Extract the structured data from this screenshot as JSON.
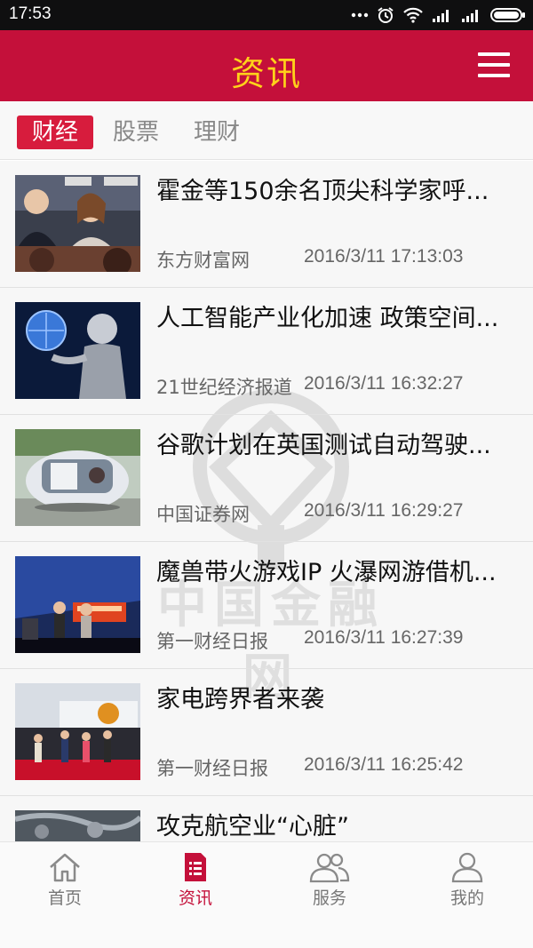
{
  "status_bar": {
    "time": "17:53"
  },
  "header": {
    "title": "资讯"
  },
  "tabs": [
    {
      "label": "财经",
      "active": true
    },
    {
      "label": "股票",
      "active": false
    },
    {
      "label": "理财",
      "active": false
    }
  ],
  "watermark": {
    "text": "中国金融网"
  },
  "news": [
    {
      "title": "霍金等150余名顶尖科学家呼...",
      "source": "东方财富网",
      "time": "2016/3/11 17:13:03"
    },
    {
      "title": "人工智能产业化加速 政策空间...",
      "source": "21世纪经济报道",
      "time": "2016/3/11 16:32:27"
    },
    {
      "title": "谷歌计划在英国测试自动驾驶...",
      "source": "中国证券网",
      "time": "2016/3/11 16:29:27"
    },
    {
      "title": "魔兽带火游戏IP 火瀑网游借机...",
      "source": "第一财经日报",
      "time": "2016/3/11 16:27:39"
    },
    {
      "title": "家电跨界者来袭",
      "source": "第一财经日报",
      "time": "2016/3/11 16:25:42"
    },
    {
      "title": "攻克航空业“心脏”",
      "source": "",
      "time": ""
    }
  ],
  "bottom_nav": [
    {
      "label": "首页",
      "icon": "home-icon",
      "active": false
    },
    {
      "label": "资讯",
      "icon": "document-list-icon",
      "active": true
    },
    {
      "label": "服务",
      "icon": "users-icon",
      "active": false
    },
    {
      "label": "我的",
      "icon": "user-icon",
      "active": false
    }
  ],
  "colors": {
    "brand_red": "#c4103a",
    "title_yellow": "#ffd21a",
    "tab_active": "#d71c3d"
  }
}
